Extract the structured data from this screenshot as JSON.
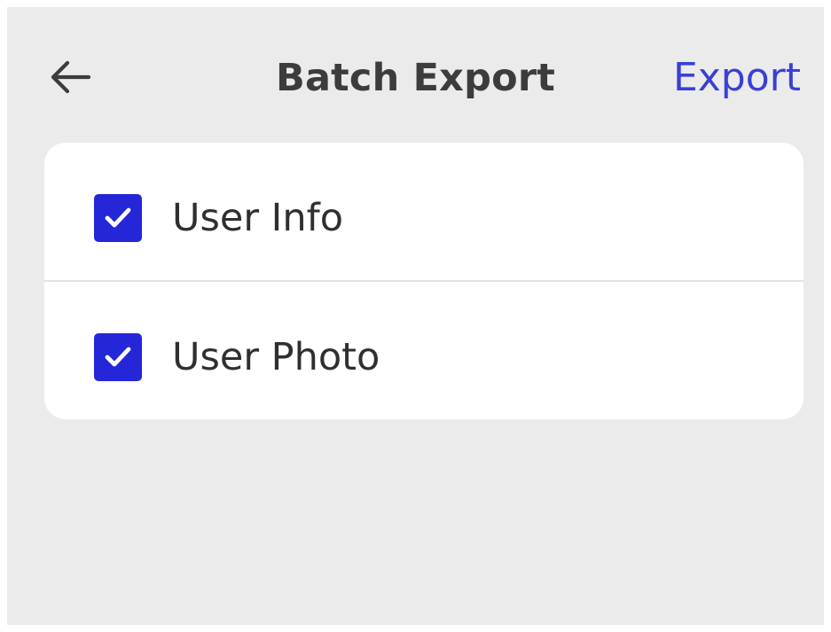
{
  "header": {
    "title": "Batch Export",
    "action_label": "Export",
    "back_icon": "arrow-left-icon"
  },
  "options": [
    {
      "label": "User Info",
      "checked": true
    },
    {
      "label": "User Photo",
      "checked": true
    }
  ],
  "colors": {
    "background": "#ebebeb",
    "card": "#ffffff",
    "accent": "#3b3fd6",
    "checkbox": "#2526d8",
    "title": "#3c3c3c",
    "text": "#2f2f2f"
  }
}
